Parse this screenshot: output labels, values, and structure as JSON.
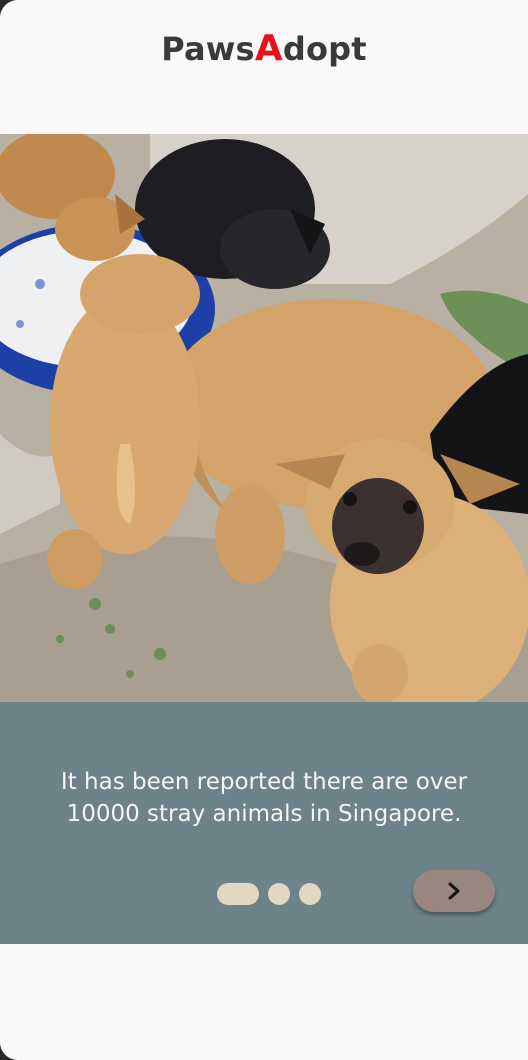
{
  "app": {
    "logo_prefix": "Paws",
    "logo_accent": "A",
    "logo_suffix": "dopt",
    "accent_color": "#e8111b"
  },
  "onboarding": {
    "image": {
      "subject": "puppies eating from a blue bowl",
      "icon": "photo-image"
    },
    "message_line1": "It has been reported there are over",
    "message_line2": "10000 stray animals in Singapore.",
    "panel_color": "#6c8389",
    "pagination": {
      "total": 3,
      "current": 1
    },
    "next_button": {
      "icon": "chevron-right-icon",
      "color": "#9a8680"
    }
  }
}
